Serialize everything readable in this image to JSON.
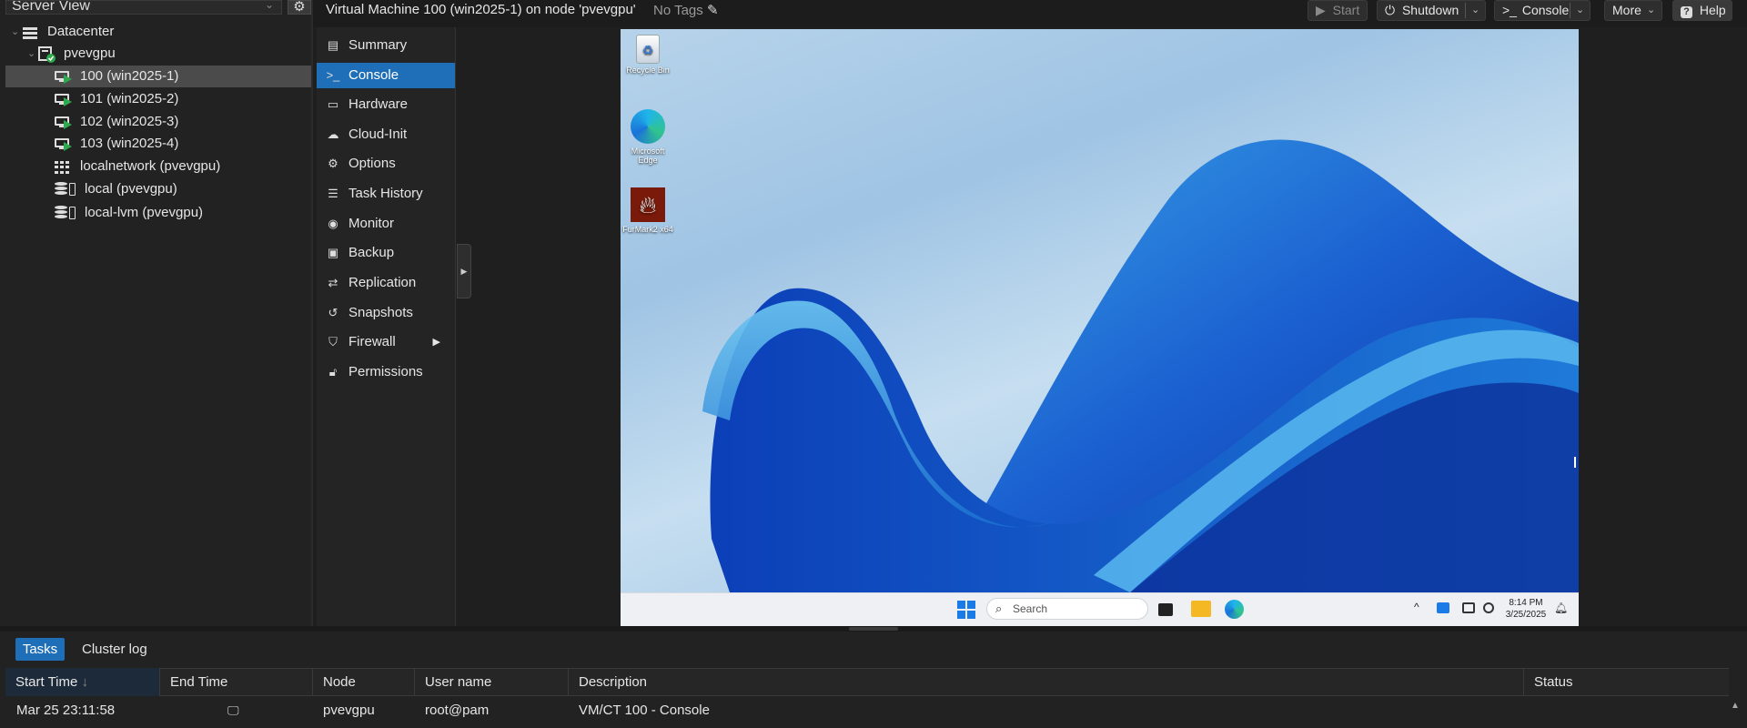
{
  "left_panel": {
    "view_selector": "Server View",
    "tree": [
      {
        "label": "Datacenter",
        "icon": "datacenter-icon"
      },
      {
        "label": "pvevgpu",
        "icon": "node-online-icon"
      },
      {
        "label": "100 (win2025-1)",
        "icon": "vm-running-icon",
        "selected": true
      },
      {
        "label": "101 (win2025-2)",
        "icon": "vm-running-icon"
      },
      {
        "label": "102 (win2025-3)",
        "icon": "vm-running-icon"
      },
      {
        "label": "103 (win2025-4)",
        "icon": "vm-running-icon"
      },
      {
        "label": "localnetwork (pvevgpu)",
        "icon": "network-icon"
      },
      {
        "label": "local (pvevgpu)",
        "icon": "storage-icon"
      },
      {
        "label": "local-lvm (pvevgpu)",
        "icon": "storage-icon"
      }
    ]
  },
  "header": {
    "title": "Virtual Machine 100 (win2025-1) on node 'pvevgpu'",
    "tags": "No Tags",
    "buttons": {
      "start": "Start",
      "shutdown": "Shutdown",
      "console": "Console",
      "more": "More",
      "help": "Help"
    }
  },
  "vm_nav": [
    {
      "label": "Summary",
      "icon": "summary-icon"
    },
    {
      "label": "Console",
      "icon": "terminal-icon",
      "selected": true
    },
    {
      "label": "Hardware",
      "icon": "monitor-icon"
    },
    {
      "label": "Cloud-Init",
      "icon": "cloud-icon"
    },
    {
      "label": "Options",
      "icon": "gear-icon"
    },
    {
      "label": "Task History",
      "icon": "list-icon"
    },
    {
      "label": "Monitor",
      "icon": "eye-icon"
    },
    {
      "label": "Backup",
      "icon": "floppy-icon"
    },
    {
      "label": "Replication",
      "icon": "retweet-icon"
    },
    {
      "label": "Snapshots",
      "icon": "history-icon"
    },
    {
      "label": "Firewall",
      "icon": "shield-icon"
    },
    {
      "label": "Permissions",
      "icon": "unlock-icon"
    }
  ],
  "console": {
    "desktop_icons": [
      "Recycle Bin",
      "Microsoft Edge",
      "FurMark2 x64"
    ],
    "taskbar": {
      "search_placeholder": "Search",
      "time": "8:14 PM",
      "date": "3/25/2025"
    }
  },
  "bottom_panel": {
    "tabs": [
      "Tasks",
      "Cluster log"
    ],
    "columns": [
      "Start Time",
      "End Time",
      "Node",
      "User name",
      "Description",
      "Status"
    ],
    "sorted_column": "Start Time",
    "rows": [
      {
        "start_time": "Mar 25 23:11:58",
        "end_time_icon": "monitor-icon",
        "node": "pvevgpu",
        "user": "root@pam",
        "description": "VM/CT 100 - Console",
        "status": ""
      }
    ]
  },
  "colors": {
    "accent": "#1f6fb8",
    "running": "#2fa84f",
    "background": "#1f1f1f"
  }
}
